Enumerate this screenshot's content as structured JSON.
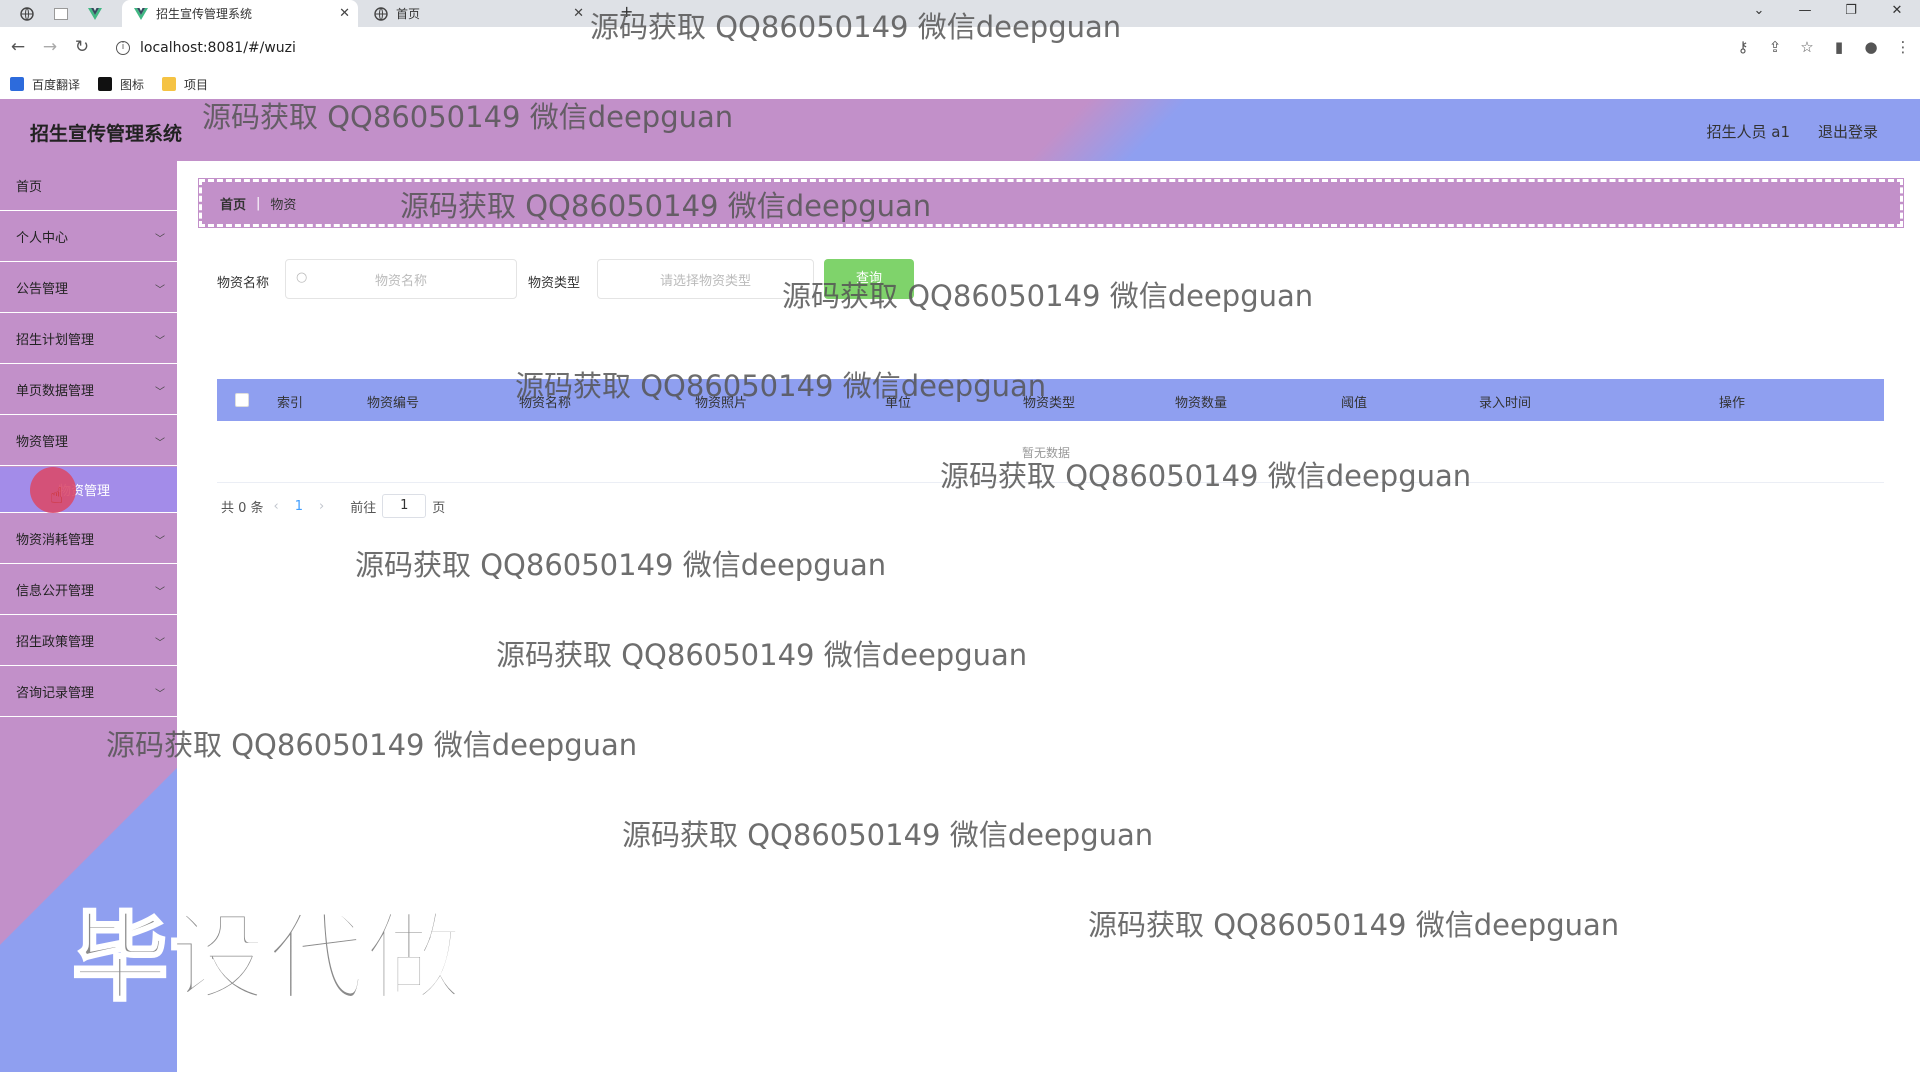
{
  "browser": {
    "tabs": [
      {
        "label": "招生宣传管理系统",
        "active": true
      },
      {
        "label": "首页",
        "active": false
      }
    ],
    "url": "localhost:8081/#/wuzi",
    "bookmarks": [
      "百度翻译",
      "图标",
      "项目"
    ]
  },
  "header": {
    "title": "招生宣传管理系统",
    "user": "招生人员 a1",
    "logout": "退出登录"
  },
  "sidebar": {
    "items": [
      {
        "label": "首页",
        "has_chevron": false
      },
      {
        "label": "个人中心",
        "has_chevron": true
      },
      {
        "label": "公告管理",
        "has_chevron": true
      },
      {
        "label": "招生计划管理",
        "has_chevron": true
      },
      {
        "label": "单页数据管理",
        "has_chevron": true
      },
      {
        "label": "物资管理",
        "has_chevron": true
      },
      {
        "label": "物资消耗管理",
        "has_chevron": true
      },
      {
        "label": "信息公开管理",
        "has_chevron": true
      },
      {
        "label": "招生政策管理",
        "has_chevron": true
      },
      {
        "label": "咨询记录管理",
        "has_chevron": true
      }
    ],
    "active_subitem": "物资管理"
  },
  "breadcrumb": {
    "home": "首页",
    "current": "物资"
  },
  "search": {
    "name_label": "物资名称",
    "name_placeholder": "物资名称",
    "type_label": "物资类型",
    "type_placeholder": "请选择物资类型",
    "button": "查询"
  },
  "table": {
    "columns": [
      "索引",
      "物资编号",
      "物资名称",
      "物资照片",
      "单位",
      "物资类型",
      "物资数量",
      "阈值",
      "录入时间",
      "操作"
    ],
    "rows": [],
    "empty_text": "暂无数据"
  },
  "pagination": {
    "total": "共 0 条",
    "current_page": "1",
    "goto_prefix": "前往",
    "goto_value": "1",
    "goto_suffix": "页"
  },
  "watermark": {
    "text": "源码获取 QQ86050149 微信deepguan",
    "big": "毕设代做"
  },
  "colors": {
    "primary_purple": "#c290c9",
    "accent_blue": "#8f9ff0",
    "search_green": "#7fd36b",
    "active_sub": "#a38ce9"
  }
}
